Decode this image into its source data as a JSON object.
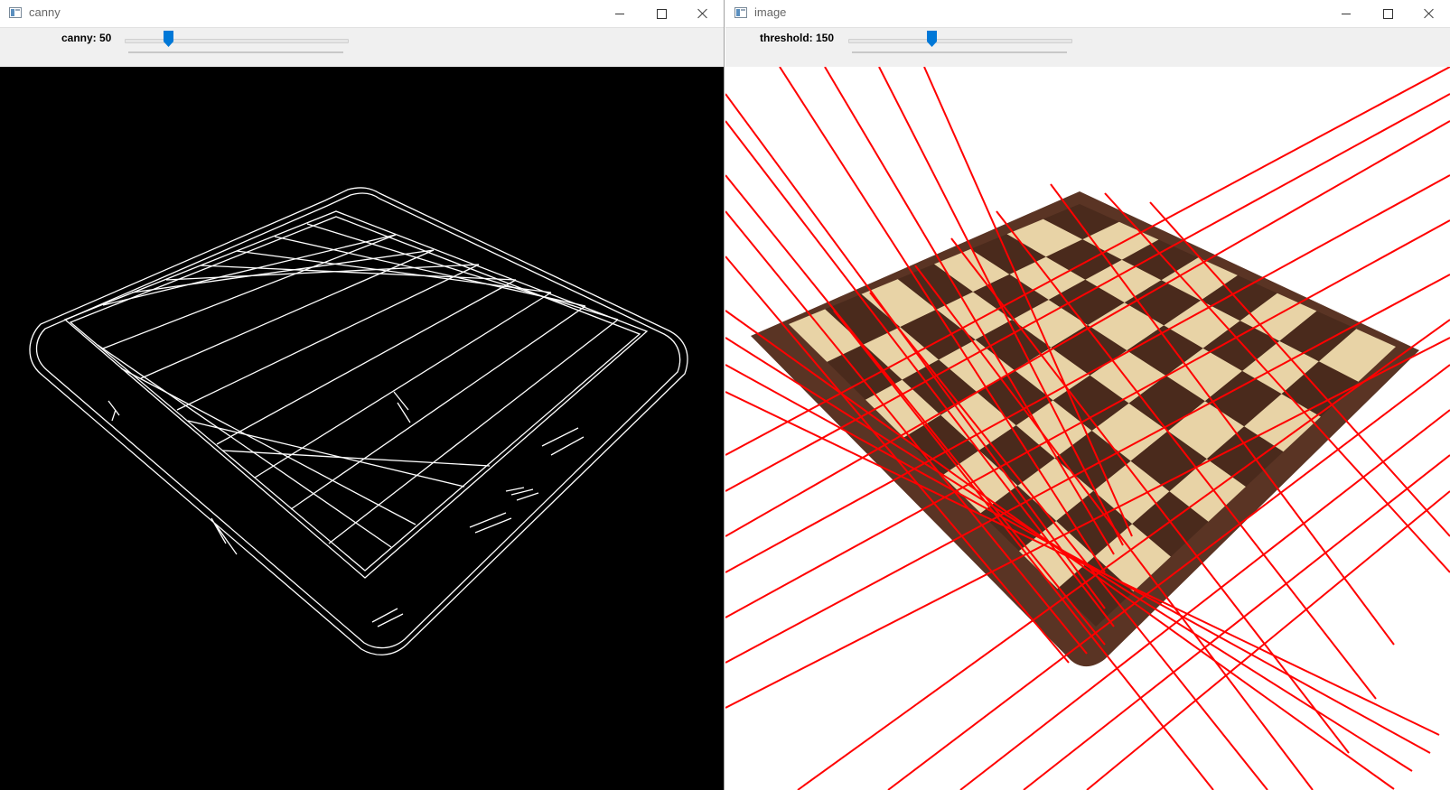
{
  "windows": {
    "canny": {
      "title": "canny",
      "trackbar": {
        "label": "canny: 50",
        "value": 50,
        "max": 255
      }
    },
    "image": {
      "title": "image",
      "trackbar": {
        "label": "threshold: 150",
        "value": 150,
        "max": 400
      }
    }
  },
  "icons": {
    "app": "window-app-icon",
    "minimize": "minimize-icon",
    "maximize": "maximize-icon",
    "close": "close-icon"
  },
  "colors": {
    "thumb": "#0078d7",
    "hough_line": "#ff0000",
    "edge": "#ffffff",
    "board_dark": "#4a2a1c",
    "board_light": "#e8d3a6"
  }
}
